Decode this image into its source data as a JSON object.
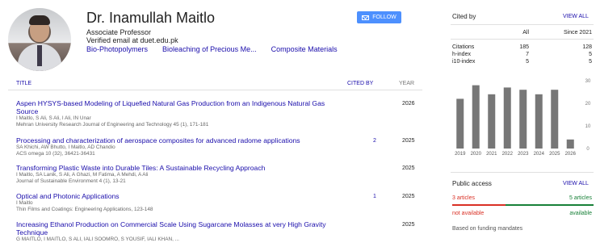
{
  "profile": {
    "name": "Dr. Inamullah Maitlo",
    "affiliation": "Associate Professor",
    "email": "Verified email at duet.edu.pk",
    "interests": [
      "Bio-Photopolymers",
      "Bioleaching of Precious Me...",
      "Composite Materials"
    ],
    "follow_label": "FOLLOW"
  },
  "table": {
    "col_title": "TITLE",
    "col_cited": "CITED BY",
    "col_year": "YEAR"
  },
  "articles": [
    {
      "title": "Aspen HYSYS-based Modeling of Liquefied Natural Gas Production from an Indigenous Natural Gas Source",
      "authors": "I Maitlo, S Ali, S Ali, I Ali, IN Unar",
      "venue": "Mehran University Research Journal of Engineering and Technology 45 (1), 171-181",
      "cited": "",
      "year": "2026"
    },
    {
      "title": "Processing and characterization of aerospace composites for advanced radome applications",
      "authors": "SA Khichi, AW Bhutto, I Maitlo, AD Chandio",
      "venue": "ACS omega 10 (32), 36421-36431",
      "cited": "2",
      "year": "2025"
    },
    {
      "title": "Transforming Plastic Waste into Durable Tiles: A Sustainable Recycling Approach",
      "authors": "I Maitlo, SA Lanik, S Ali, A Ghazi, M Fatima, A Mehdi, A Ali",
      "venue": "Journal of Sustainable Environment 4 (1), 13-21",
      "cited": "",
      "year": "2025"
    },
    {
      "title": "Optical and Photonic Applications",
      "authors": "I Maitlo",
      "venue": "Thin Films and Coatings: Engineering Applications, 123-148",
      "cited": "1",
      "year": "2025"
    },
    {
      "title": "Increasing Ethanol Production on Commercial Scale Using Sugarcane Molasses at very High Gravity Technique",
      "authors": "G MAITLO, I MAITLO, S ALI, IALI SOOMRO, S YOUSIF, IALI KHAN, ...",
      "venue": "",
      "cited": "",
      "year": "2025"
    }
  ],
  "cited_by": {
    "title": "Cited by",
    "view_all": "VIEW ALL",
    "col_all": "All",
    "col_since": "Since 2021",
    "rows": [
      {
        "label": "Citations",
        "all": "185",
        "since": "128"
      },
      {
        "label": "h-index",
        "all": "7",
        "since": "5"
      },
      {
        "label": "i10-index",
        "all": "5",
        "since": "5"
      }
    ]
  },
  "chart_data": {
    "type": "bar",
    "categories": [
      "2019",
      "2020",
      "2021",
      "2022",
      "2023",
      "2024",
      "2025",
      "2026"
    ],
    "values": [
      22,
      28,
      24,
      27,
      26,
      24,
      26,
      4
    ],
    "ylim": [
      0,
      30
    ],
    "yticks": [
      "0",
      "10",
      "20",
      "30"
    ],
    "color": "#777777"
  },
  "public_access": {
    "title": "Public access",
    "view_all": "VIEW ALL",
    "not_available_count": "3 articles",
    "available_count": "5 articles",
    "not_available_label": "not available",
    "available_label": "available",
    "not_available_fraction": 0.375,
    "footer": "Based on funding mandates"
  }
}
